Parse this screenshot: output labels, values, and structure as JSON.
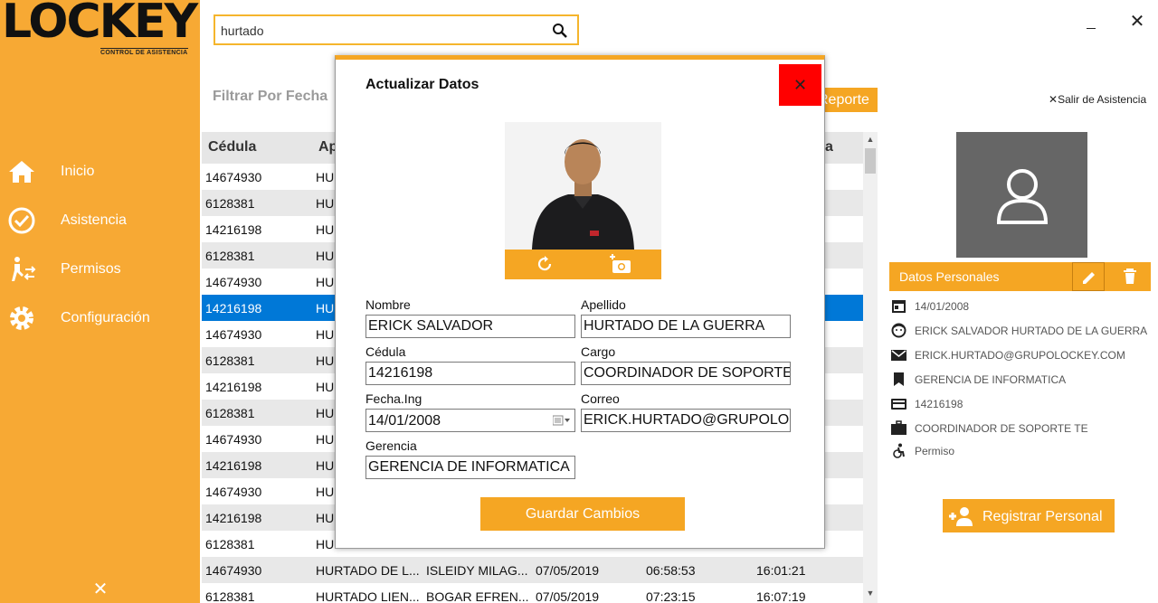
{
  "app": {
    "logo_text": "LOCKEY",
    "logo_subtitle": "CONTROL DE ASISTENCIA"
  },
  "sidebar": {
    "items": [
      {
        "label": "Inicio",
        "icon": "home-icon"
      },
      {
        "label": "Asistencia",
        "icon": "check-circle-icon"
      },
      {
        "label": "Permisos",
        "icon": "permissions-icon"
      },
      {
        "label": "Configuración",
        "icon": "gear-icon"
      }
    ],
    "close_glyph": "✕"
  },
  "search": {
    "value": "hurtado"
  },
  "filter": {
    "label": "Filtrar Por Fecha"
  },
  "report_button": "Reporte",
  "exit_link": "Salir de Asistencia",
  "table": {
    "headers": [
      "Cédula",
      "Apellido",
      "",
      "",
      "",
      "a"
    ],
    "rows": [
      [
        "14674930",
        "HU",
        "",
        "",
        "",
        ""
      ],
      [
        "6128381",
        "HU",
        "",
        "",
        "",
        ""
      ],
      [
        "14216198",
        "HU",
        "",
        "",
        "",
        ""
      ],
      [
        "6128381",
        "HU",
        "",
        "",
        "",
        ""
      ],
      [
        "14674930",
        "HU",
        "",
        "",
        "",
        ""
      ],
      [
        "14216198",
        "HU",
        "",
        "",
        "",
        ""
      ],
      [
        "14674930",
        "HU",
        "",
        "",
        "",
        ""
      ],
      [
        "6128381",
        "HU",
        "",
        "",
        "",
        ""
      ],
      [
        "14216198",
        "HU",
        "",
        "",
        "",
        ""
      ],
      [
        "6128381",
        "HU",
        "",
        "",
        "",
        ""
      ],
      [
        "14674930",
        "HU",
        "",
        "",
        "",
        ""
      ],
      [
        "14216198",
        "HU",
        "",
        "",
        "",
        ""
      ],
      [
        "14674930",
        "HU",
        "",
        "",
        "",
        ""
      ],
      [
        "14216198",
        "HU",
        "",
        "",
        "",
        ""
      ],
      [
        "6128381",
        "HU",
        "",
        "",
        "",
        ""
      ],
      [
        "14674930",
        "HURTADO DE L...",
        "ISLEIDY MILAG...",
        "07/05/2019",
        "06:58:53",
        "16:01:21"
      ],
      [
        "6128381",
        "HURTADO LIEN...",
        "BOGAR EFREN...",
        "07/05/2019",
        "07:23:15",
        "16:07:19"
      ]
    ],
    "selected_index": 5
  },
  "profile": {
    "section_title": "Datos Personales",
    "fields": [
      {
        "icon": "calendar-icon",
        "text": "14/01/2008"
      },
      {
        "icon": "face-icon",
        "text": "ERICK SALVADOR HURTADO DE LA GUERRA"
      },
      {
        "icon": "mail-icon",
        "text": "ERICK.HURTADO@GRUPOLOCKEY.COM"
      },
      {
        "icon": "bookmark-icon",
        "text": "GERENCIA DE INFORMATICA"
      },
      {
        "icon": "card-icon",
        "text": "14216198"
      },
      {
        "icon": "briefcase-icon",
        "text": "COORDINADOR DE SOPORTE TE"
      },
      {
        "icon": "accessible-icon",
        "text": "Permiso"
      }
    ],
    "register_button": "Registrar Personal"
  },
  "modal": {
    "title": "Actualizar Datos",
    "close_glyph": "✕",
    "fields": {
      "nombre": {
        "label": "Nombre",
        "value": "ERICK SALVADOR"
      },
      "apellido": {
        "label": "Apellido",
        "value": "HURTADO DE LA GUERRA"
      },
      "cedula": {
        "label": "Cédula",
        "value": "14216198"
      },
      "cargo": {
        "label": "Cargo",
        "value": "COORDINADOR DE SOPORTE"
      },
      "fecha": {
        "label": "Fecha.Ing",
        "value": "14/01/2008"
      },
      "correo": {
        "label": "Correo",
        "value": "ERICK.HURTADO@GRUPOLOC"
      },
      "gerencia": {
        "label": "Gerencia",
        "value": "GERENCIA DE INFORMATICA"
      }
    },
    "save_button": "Guardar Cambios"
  },
  "colors": {
    "accent": "#F5A623",
    "sidebar": "#F7A934",
    "selection": "#0078D7",
    "modal_close": "#FF0000"
  }
}
